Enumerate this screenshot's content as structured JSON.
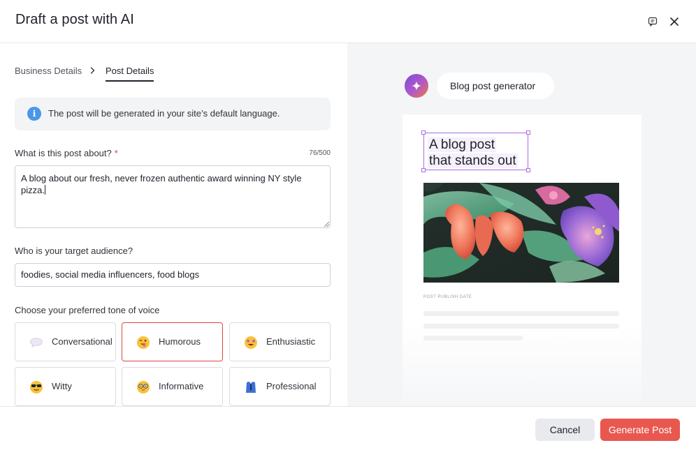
{
  "dialog": {
    "title": "Draft a post with AI"
  },
  "breadcrumb": {
    "step1": "Business Details",
    "step2": "Post Details"
  },
  "info_banner": {
    "text": "The post will be generated in your site’s default language."
  },
  "post_about": {
    "label": "What is this post about?",
    "required_mark": "*",
    "counter": "76/500",
    "value": "A blog about our fresh, never frozen authentic award winning NY style pizza."
  },
  "audience": {
    "label": "Who is your target audience?",
    "value": "foodies, social media influencers, food blogs"
  },
  "tone": {
    "label": "Choose your preferred tone of voice",
    "selected": "Humorous",
    "options": [
      {
        "label": "Conversational",
        "icon": "speech-bubble-icon"
      },
      {
        "label": "Humorous",
        "icon": "winking-tongue-face-icon"
      },
      {
        "label": "Enthusiastic",
        "icon": "star-struck-face-icon"
      },
      {
        "label": "Witty",
        "icon": "sunglasses-face-icon"
      },
      {
        "label": "Informative",
        "icon": "nerd-face-icon"
      },
      {
        "label": "Professional",
        "icon": "suit-icon"
      }
    ]
  },
  "preview": {
    "chip_label": "Blog post generator",
    "headline_line1": "A blog post",
    "headline_line2": "that stands out",
    "date_label": "POST PUBLISH DATE"
  },
  "footer": {
    "cancel_label": "Cancel",
    "generate_label": "Generate Post"
  },
  "colors": {
    "accent": "#e8584f",
    "selected_border": "#e0443c",
    "info_blue": "#4a97e8",
    "selection_purple": "#a96ddf"
  }
}
